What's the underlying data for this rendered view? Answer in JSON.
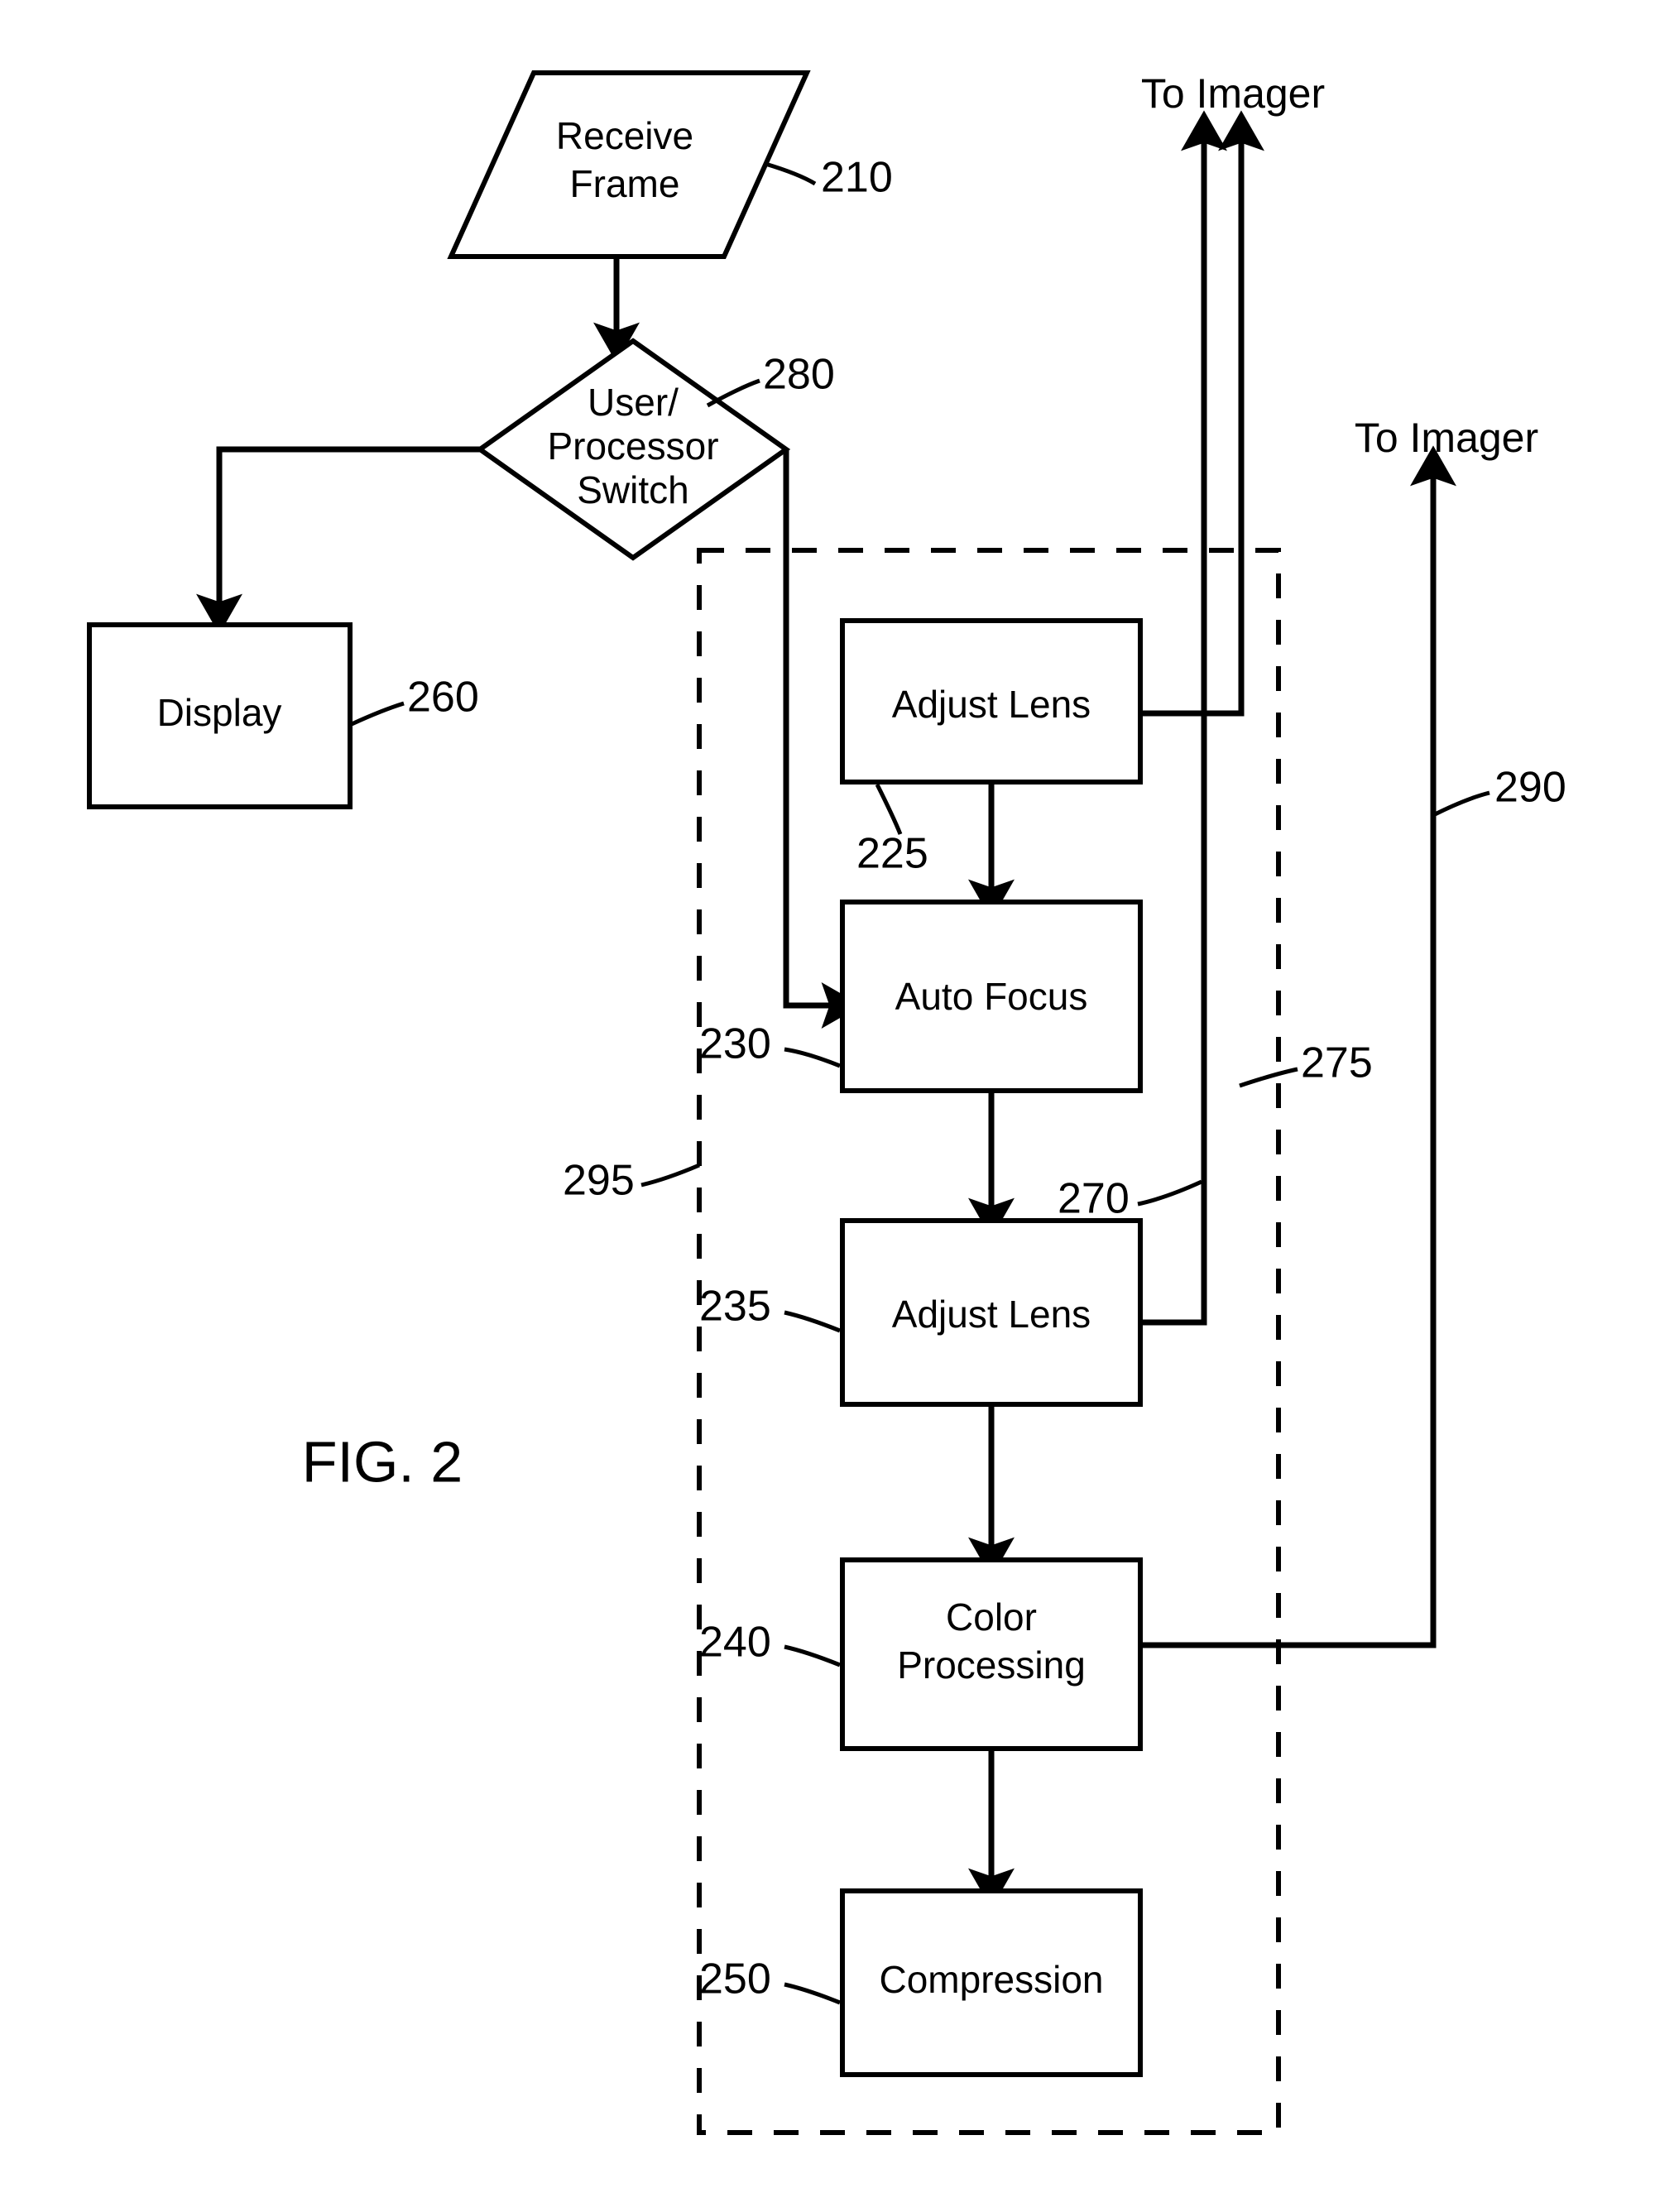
{
  "figure": {
    "caption": "FIG. 2",
    "accent_color": "#000000",
    "background_color": "#ffffff"
  },
  "nodes": {
    "receive_frame": {
      "label_line1": "Receive",
      "label_line2": "Frame",
      "ref": "210",
      "shape": "parallelogram"
    },
    "switch": {
      "label_line1": "User/",
      "label_line2": "Processor",
      "label_line3": "Switch",
      "ref": "280",
      "shape": "diamond"
    },
    "display": {
      "label": "Display",
      "ref": "260",
      "shape": "rectangle"
    },
    "adjust_lens_1": {
      "label": "Adjust Lens",
      "ref": "225",
      "shape": "rectangle"
    },
    "auto_focus": {
      "label": "Auto Focus",
      "ref": "230",
      "shape": "rectangle"
    },
    "adjust_lens_2": {
      "label": "Adjust Lens",
      "ref": "235",
      "shape": "rectangle"
    },
    "color_processing": {
      "label_line1": "Color",
      "label_line2": "Processing",
      "ref": "240",
      "shape": "rectangle"
    },
    "compression": {
      "label": "Compression",
      "ref": "250",
      "shape": "rectangle"
    }
  },
  "outputs": {
    "to_imager_top": "To Imager",
    "to_imager_right": "To Imager"
  },
  "reference_numerals": {
    "n210": "210",
    "n225": "225",
    "n230": "230",
    "n235": "235",
    "n240": "240",
    "n250": "250",
    "n260": "260",
    "n270": "270",
    "n275": "275",
    "n280": "280",
    "n290": "290",
    "n295": "295"
  },
  "chart_data": {
    "type": "table",
    "title": "FIG. 2",
    "nodes": [
      {
        "ref": "210",
        "text": "Receive Frame",
        "shape": "parallelogram"
      },
      {
        "ref": "280",
        "text": "User/Processor Switch",
        "shape": "diamond"
      },
      {
        "ref": "260",
        "text": "Display",
        "shape": "rectangle"
      },
      {
        "ref": "225",
        "text": "Adjust Lens",
        "shape": "rectangle"
      },
      {
        "ref": "230",
        "text": "Auto Focus",
        "shape": "rectangle"
      },
      {
        "ref": "235",
        "text": "Adjust Lens",
        "shape": "rectangle"
      },
      {
        "ref": "240",
        "text": "Color Processing",
        "shape": "rectangle"
      },
      {
        "ref": "250",
        "text": "Compression",
        "shape": "rectangle"
      },
      {
        "ref": "295",
        "text": "dashed processing boundary",
        "shape": "dashed-rectangle"
      }
    ],
    "edges": [
      {
        "from": "210",
        "to": "280",
        "style": "arrow-down"
      },
      {
        "from": "280",
        "to": "260",
        "style": "arrow-left-down"
      },
      {
        "from": "280",
        "to": "230",
        "style": "arrow-right-down-right"
      },
      {
        "from": "225",
        "to": "230",
        "style": "arrow-down"
      },
      {
        "from": "230",
        "to": "235",
        "style": "arrow-down"
      },
      {
        "from": "235",
        "to": "240",
        "style": "arrow-down"
      },
      {
        "from": "240",
        "to": "250",
        "style": "arrow-down"
      },
      {
        "from": "225",
        "to": "To Imager",
        "label": "275",
        "style": "arrow-right-up"
      },
      {
        "from": "235",
        "to": "To Imager",
        "label": "270",
        "style": "arrow-right-up"
      },
      {
        "from": "240",
        "to": "To Imager",
        "label": "290",
        "style": "arrow-right-up"
      }
    ]
  }
}
